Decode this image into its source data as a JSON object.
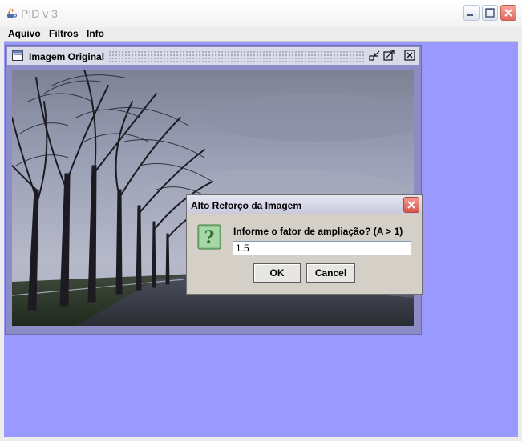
{
  "window": {
    "title": "PID v 3",
    "icon": "java-cup-icon",
    "buttons": [
      "minimize-icon",
      "maximize-icon",
      "close-icon"
    ]
  },
  "menu": {
    "items": [
      "Aquivo",
      "Filtros",
      "Info"
    ]
  },
  "internal_frame": {
    "title": "Imagem Original",
    "icon": "frame-icon",
    "buttons": [
      "iconify-icon",
      "maximize-icon",
      "close-icon"
    ]
  },
  "dialog": {
    "title": "Alto Reforço da Imagem",
    "message": "Informe o fator de ampliação? (A > 1)",
    "input_value": "1.5",
    "ok_label": "OK",
    "cancel_label": "Cancel",
    "icon": "question-icon"
  },
  "colors": {
    "desktop": "#9999ff",
    "frame": "#8c8cc7",
    "dialog_bg": "#d4d0c8",
    "close_red": "#d8554a"
  }
}
